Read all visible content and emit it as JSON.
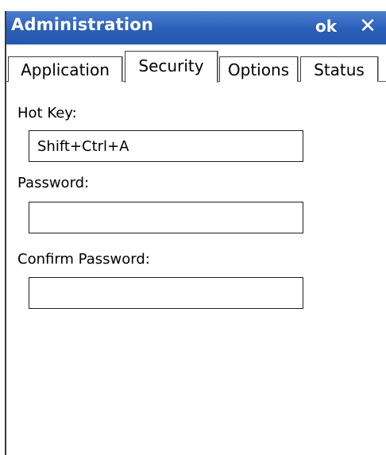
{
  "window": {
    "title": "Administration",
    "ok_label": "ok",
    "close_label": "✕"
  },
  "tabs": [
    {
      "label": "Application",
      "active": false
    },
    {
      "label": "Security",
      "active": true
    },
    {
      "label": "Options",
      "active": false
    },
    {
      "label": "Status",
      "active": false
    }
  ],
  "form": {
    "hotkey_label": "Hot Key:",
    "hotkey_value": "Shift+Ctrl+A",
    "password_label": "Password:",
    "password_value": "",
    "confirm_label": "Confirm Password:",
    "confirm_value": ""
  },
  "colors": {
    "titlebar": "#2a5fb8",
    "title_text": "#ffffff"
  }
}
